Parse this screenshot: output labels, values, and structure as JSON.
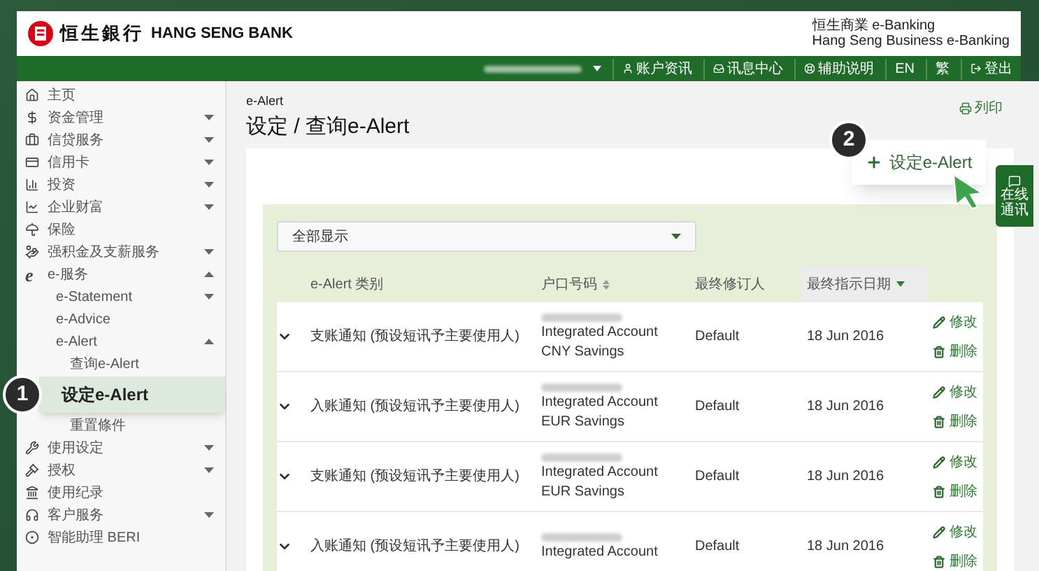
{
  "header": {
    "logo_text": "恒生銀行",
    "bank_name": "HANG SENG BANK",
    "product_lines": [
      "恒生商業 e-Banking",
      "Hang Seng Business e-Banking"
    ]
  },
  "nav": {
    "links": [
      {
        "label": "账户资讯",
        "kind": "icon"
      },
      {
        "label": "讯息中心",
        "kind": "icon"
      },
      {
        "label": "辅助说明",
        "kind": "icon"
      },
      {
        "label": "EN",
        "kind": "text"
      },
      {
        "label": "繁",
        "kind": "text"
      },
      {
        "label": "登出",
        "kind": "icon"
      }
    ]
  },
  "sidebar": {
    "items": [
      {
        "label": "主页",
        "kind": "top"
      },
      {
        "label": "资金管理",
        "kind": "top",
        "expanded": false
      },
      {
        "label": "信贷服务",
        "kind": "top",
        "expanded": false
      },
      {
        "label": "信用卡",
        "kind": "top",
        "expanded": false
      },
      {
        "label": "投资",
        "kind": "top",
        "expanded": false
      },
      {
        "label": "企业财富",
        "kind": "top",
        "expanded": false
      },
      {
        "label": "保险",
        "kind": "top"
      },
      {
        "label": "强积金及支薪服务",
        "kind": "top",
        "expanded": false
      },
      {
        "label": "e-服务",
        "kind": "top",
        "expanded": true,
        "glyph": "e"
      },
      {
        "label": "e-Statement",
        "kind": "sub",
        "expanded": false
      },
      {
        "label": "e-Advice",
        "kind": "sub"
      },
      {
        "label": "e-Alert",
        "kind": "sub",
        "expanded": true
      },
      {
        "label": "查询e-Alert",
        "kind": "subsub"
      },
      {
        "label": "设定e-Alert",
        "kind": "callout",
        "step": "1"
      },
      {
        "label": "重置條件",
        "kind": "subsub"
      },
      {
        "label": "使用设定",
        "kind": "top",
        "expanded": false
      },
      {
        "label": "授权",
        "kind": "top",
        "expanded": false
      },
      {
        "label": "使用纪录",
        "kind": "top"
      },
      {
        "label": "客户服务",
        "kind": "top",
        "expanded": false
      },
      {
        "label": "智能助理 BERI",
        "kind": "top"
      }
    ]
  },
  "page": {
    "breadcrumb": "e-Alert",
    "title": "设定 / 查询e-Alert",
    "print": "列印",
    "add_button": {
      "label": "设定e-Alert",
      "step": "2"
    },
    "filter": {
      "value": "全部显示"
    },
    "table": {
      "columns": [
        {
          "label": "e-Alert 类别",
          "sortable": false,
          "selected": false
        },
        {
          "label": "户口号码",
          "sortable": true,
          "selected": false
        },
        {
          "label": "最终修订人",
          "sortable": false,
          "selected": false
        },
        {
          "label": "最终指示日期",
          "sortable": true,
          "selected": true
        }
      ],
      "rows": [
        {
          "type": "支账通知 (预设短讯予主要使用人)",
          "account_lines": [
            "Integrated Account",
            "CNY Savings"
          ],
          "modifier": "Default",
          "date": "18 Jun 2016",
          "actions": [
            "修改",
            "删除"
          ]
        },
        {
          "type": "入账通知 (预设短讯予主要使用人)",
          "account_lines": [
            "Integrated Account",
            "EUR Savings"
          ],
          "modifier": "Default",
          "date": "18 Jun 2016",
          "actions": [
            "修改",
            "删除"
          ]
        },
        {
          "type": "支账通知 (预设短讯予主要使用人)",
          "account_lines": [
            "Integrated Account",
            "EUR Savings"
          ],
          "modifier": "Default",
          "date": "18 Jun 2016",
          "actions": [
            "修改",
            "删除"
          ]
        },
        {
          "type": "入账通知 (预设短讯予主要使用人)",
          "account_lines": [
            "Integrated Account"
          ],
          "modifier": "Default",
          "date": "18 Jun 2016",
          "actions": [
            "修改",
            "删除"
          ]
        }
      ]
    }
  },
  "chat": {
    "lines": [
      "在线",
      "通讯"
    ]
  }
}
